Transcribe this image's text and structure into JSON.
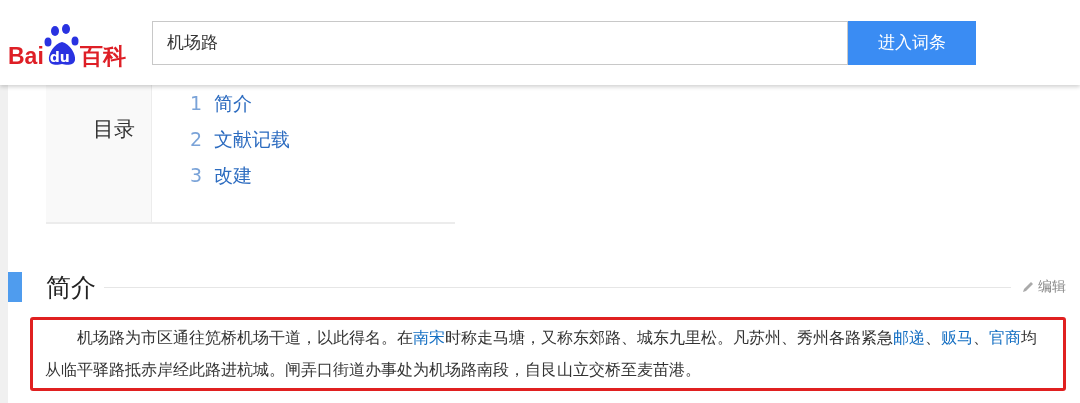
{
  "logo": {
    "parts": [
      "Bai",
      "du",
      "百科"
    ]
  },
  "search": {
    "value": "机场路",
    "button": "进入词条"
  },
  "toc": {
    "title": "目录",
    "items": [
      {
        "number": "1",
        "label": "简介"
      },
      {
        "number": "2",
        "label": "文献记载"
      },
      {
        "number": "3",
        "label": "改建"
      }
    ]
  },
  "section": {
    "title": "简介",
    "edit": "编辑",
    "paragraph": [
      {
        "text": "机场路为市区通往笕桥机场干道，以此得名。在",
        "link": false
      },
      {
        "text": "南宋",
        "link": true
      },
      {
        "text": "时称走马塘，又称东郊路、城东九里松。凡苏州、秀州各路紧急",
        "link": false
      },
      {
        "text": "邮递",
        "link": true
      },
      {
        "text": "、",
        "link": false
      },
      {
        "text": "贩马",
        "link": true
      },
      {
        "text": "、",
        "link": false
      },
      {
        "text": "官商",
        "link": true
      },
      {
        "text": "均从临平驿路抵赤岸经此路进杭城。闸弄口街道办事处为机场路南段，自艮山立交桥至麦苗港。",
        "link": false
      }
    ]
  }
}
